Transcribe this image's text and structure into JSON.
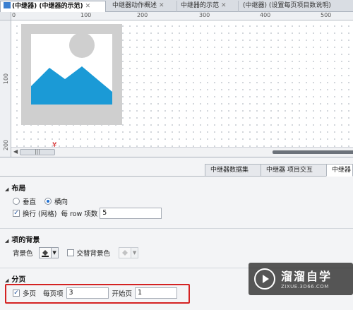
{
  "tabs": [
    {
      "label": "(中继器) (中继器的示范)",
      "close": "✕",
      "active": true
    },
    {
      "label": "中继器动作概述",
      "close": "✕",
      "active": false
    },
    {
      "label": "中继器的示范",
      "close": "✕",
      "active": false
    },
    {
      "label": "(中继器) (设置每页项目数说明)",
      "close": "",
      "active": false
    }
  ],
  "ruler": {
    "top_labels": [
      "0",
      "100",
      "200",
      "300",
      "400",
      "500"
    ],
    "left_labels": [
      "100",
      "200"
    ]
  },
  "canvas": {
    "marker": "¥",
    "scroll_thumb": "|||"
  },
  "panel_tabs": [
    "中继器数据集",
    "中继器 项目交互",
    "中继器"
  ],
  "layout_section": {
    "title": "布局",
    "vertical_label": "垂直",
    "horizontal_label": "横向",
    "wrap_label": "换行 (网格)",
    "per_row_label": "每 row 项数",
    "per_row_value": "5"
  },
  "background_section": {
    "title": "项的背景",
    "bg_color_label": "背景色",
    "alternate_label": "交替背景色"
  },
  "paging_section": {
    "title": "分页",
    "multi_page_label": "多页",
    "items_per_page_label": "每页项",
    "items_per_page_value": "3",
    "start_page_label": "开始页",
    "start_page_value": "1"
  },
  "watermark": {
    "title": "溜溜自学",
    "url": "ZIXUE.3D66.COM"
  },
  "colors": {
    "image_blue": "#1b9ad6",
    "image_gray": "#cfcfcf",
    "highlight_red": "#d42222"
  }
}
